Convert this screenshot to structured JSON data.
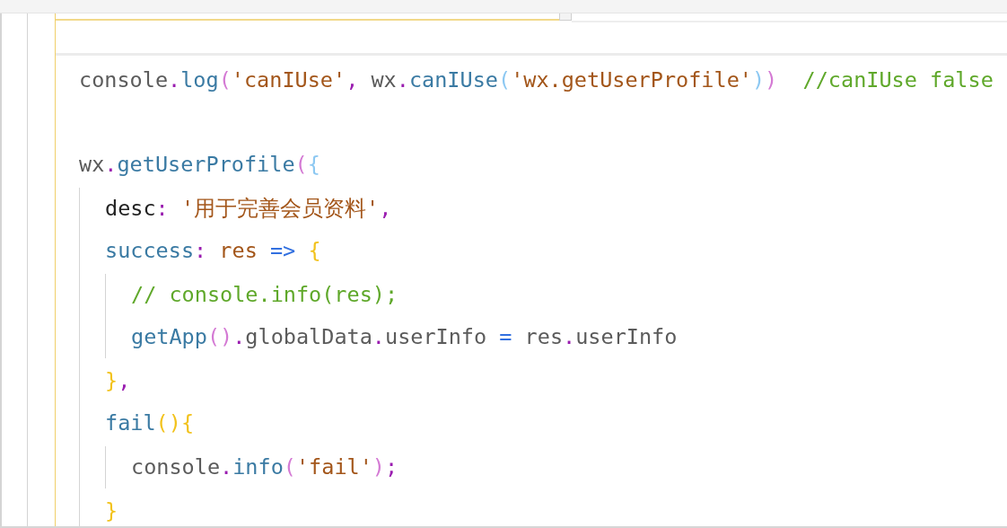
{
  "editor": {
    "lines": [
      {
        "kind": "code",
        "tokens": [
          {
            "kind": "plain",
            "text": "console"
          },
          {
            "kind": "punct",
            "text": "."
          },
          {
            "kind": "method",
            "text": "log"
          },
          {
            "kind": "paren",
            "text": "("
          },
          {
            "kind": "string",
            "text": "'canIUse'"
          },
          {
            "kind": "punct",
            "text": ","
          },
          {
            "kind": "plain",
            "text": " wx"
          },
          {
            "kind": "punct",
            "text": "."
          },
          {
            "kind": "method",
            "text": "canIUse"
          },
          {
            "kind": "paren2",
            "text": "("
          },
          {
            "kind": "string",
            "text": "'wx.getUserProfile'"
          },
          {
            "kind": "paren2",
            "text": ")"
          },
          {
            "kind": "paren",
            "text": ")"
          },
          {
            "kind": "comment",
            "text": "  //canIUse false"
          }
        ]
      },
      {
        "kind": "blank"
      },
      {
        "kind": "code",
        "tokens": [
          {
            "kind": "plain",
            "text": "wx"
          },
          {
            "kind": "punct",
            "text": "."
          },
          {
            "kind": "method",
            "text": "getUserProfile"
          },
          {
            "kind": "paren",
            "text": "("
          },
          {
            "kind": "paren2",
            "text": "{"
          }
        ],
        "children": [
          {
            "kind": "code",
            "tokens": [
              {
                "kind": "key",
                "text": "desc"
              },
              {
                "kind": "punct",
                "text": ":"
              },
              {
                "kind": "string",
                "text": " '用于完善会员资料'"
              },
              {
                "kind": "punct",
                "text": ","
              }
            ]
          },
          {
            "kind": "code",
            "tokens": [
              {
                "kind": "method",
                "text": "success"
              },
              {
                "kind": "punct",
                "text": ":"
              },
              {
                "kind": "string",
                "text": " res"
              },
              {
                "kind": "operator",
                "text": " =>"
              },
              {
                "kind": "brace",
                "text": " {"
              }
            ],
            "children": [
              {
                "kind": "code",
                "tokens": [
                  {
                    "kind": "comment",
                    "text": "// console.info(res);"
                  }
                ]
              },
              {
                "kind": "code",
                "tokens": [
                  {
                    "kind": "method",
                    "text": "getApp"
                  },
                  {
                    "kind": "paren",
                    "text": "()"
                  },
                  {
                    "kind": "punct",
                    "text": "."
                  },
                  {
                    "kind": "plain",
                    "text": "globalData"
                  },
                  {
                    "kind": "punct",
                    "text": "."
                  },
                  {
                    "kind": "plain",
                    "text": "userInfo"
                  },
                  {
                    "kind": "operator",
                    "text": " ="
                  },
                  {
                    "kind": "plain",
                    "text": " res"
                  },
                  {
                    "kind": "punct",
                    "text": "."
                  },
                  {
                    "kind": "plain",
                    "text": "userInfo"
                  }
                ]
              }
            ]
          },
          {
            "kind": "code",
            "tokens": [
              {
                "kind": "brace",
                "text": "}"
              },
              {
                "kind": "punct",
                "text": ","
              }
            ]
          },
          {
            "kind": "code",
            "tokens": [
              {
                "kind": "method",
                "text": "fail"
              },
              {
                "kind": "brace",
                "text": "(){"
              }
            ],
            "children": [
              {
                "kind": "code",
                "tokens": [
                  {
                    "kind": "plain",
                    "text": "console"
                  },
                  {
                    "kind": "punct",
                    "text": "."
                  },
                  {
                    "kind": "method",
                    "text": "info"
                  },
                  {
                    "kind": "paren",
                    "text": "("
                  },
                  {
                    "kind": "string",
                    "text": "'fail'"
                  },
                  {
                    "kind": "paren",
                    "text": ")"
                  },
                  {
                    "kind": "punct",
                    "text": ";"
                  }
                ]
              }
            ]
          },
          {
            "kind": "code",
            "tokens": [
              {
                "kind": "brace",
                "text": "}"
              }
            ]
          }
        ]
      }
    ]
  }
}
